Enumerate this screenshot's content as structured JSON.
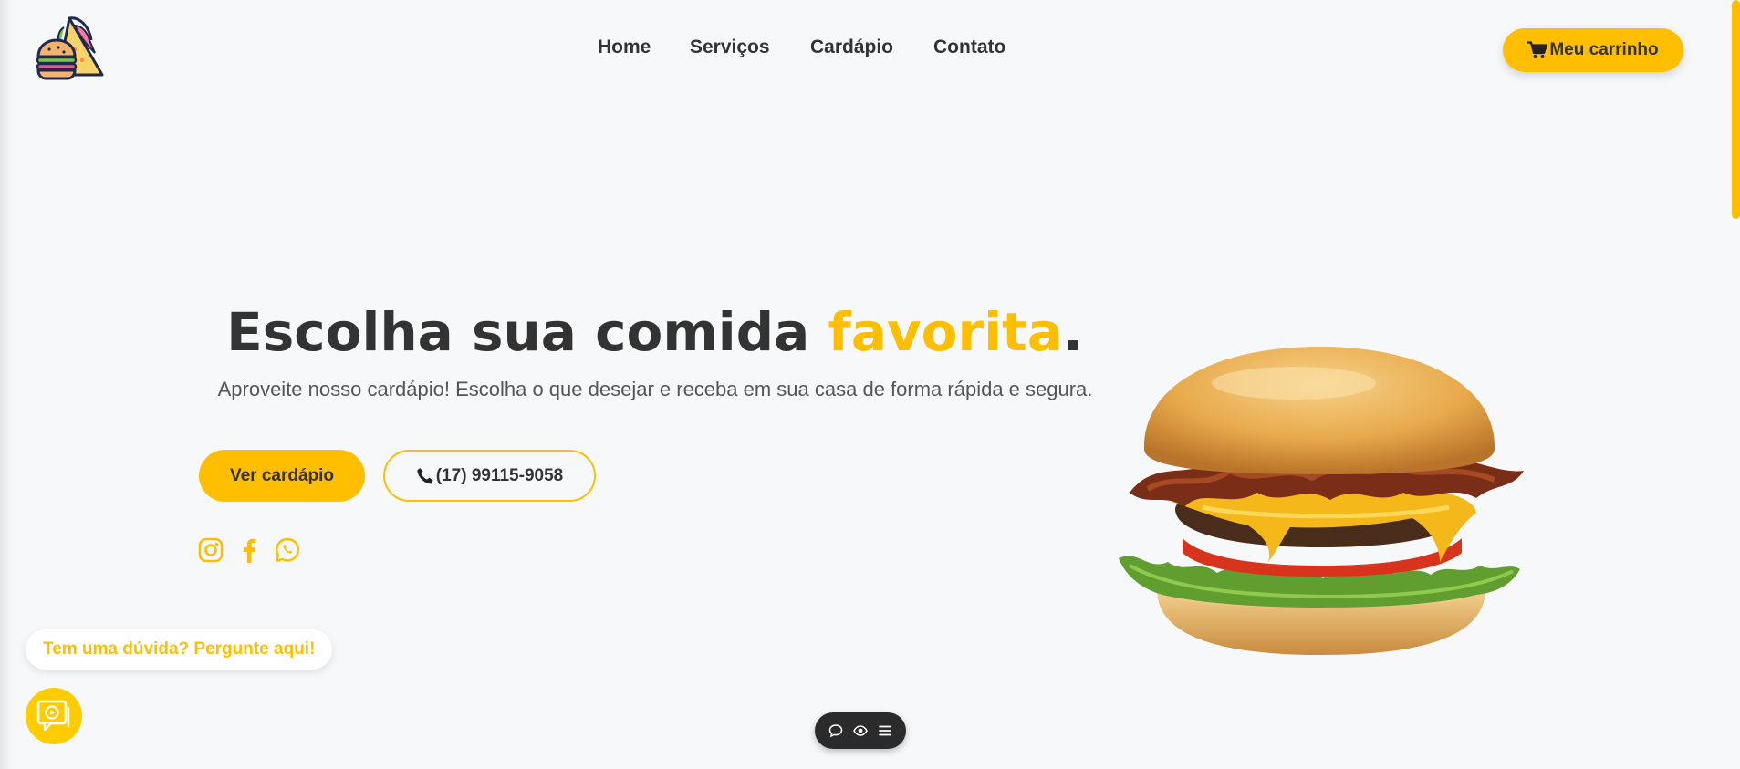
{
  "brand": {
    "accent_color": "#ffbf00",
    "logo_icon": "burger-sandwich-logo"
  },
  "nav": {
    "items": [
      {
        "label": "Home"
      },
      {
        "label": "Serviços"
      },
      {
        "label": "Cardápio"
      },
      {
        "label": "Contato"
      }
    ]
  },
  "cart": {
    "label": "Meu carrinho",
    "icon": "shopping-cart-icon"
  },
  "hero": {
    "title_main": "Escolha sua comida ",
    "title_accent": "favorita",
    "title_end": ".",
    "subtitle": "Aproveite nosso cardápio! Escolha o que desejar e receba em sua casa de forma rápida e segura.",
    "menu_button": "Ver cardápio",
    "phone_button": "(17) 99115-9058",
    "phone_icon": "phone-icon",
    "social_icons": [
      "instagram-icon",
      "facebook-icon",
      "whatsapp-icon"
    ],
    "image": "bacon-cheeseburger-image"
  },
  "chat": {
    "prompt": "Tem uma dúvida? Pergunte aqui!",
    "launcher_icon": "chat-video-icon"
  },
  "toolbar": {
    "icons": [
      "comment-icon",
      "eye-icon",
      "menu-icon"
    ]
  }
}
